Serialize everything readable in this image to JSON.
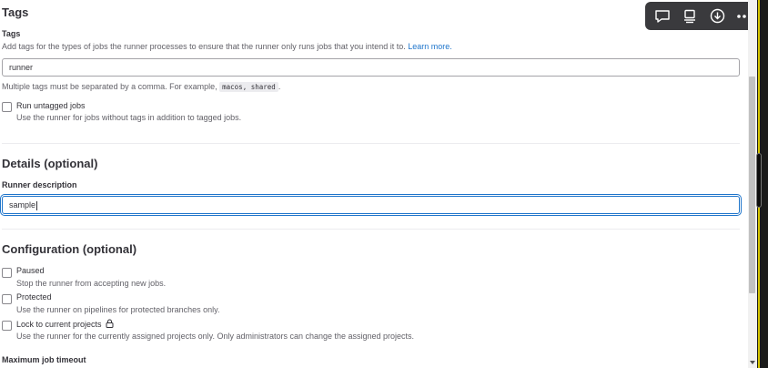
{
  "tags": {
    "section_title": "Tags",
    "label": "Tags",
    "help_text": "Add tags for the types of jobs the runner processes to ensure that the runner only runs jobs that you intend it to.",
    "learn_more": "Learn more.",
    "value": "runner",
    "separator_help_prefix": "Multiple tags must be separated by a comma. For example,",
    "separator_example": "macos, shared",
    "separator_help_suffix": ".",
    "run_untagged": {
      "label": "Run untagged jobs",
      "help": "Use the runner for jobs without tags in addition to tagged jobs.",
      "checked": false
    }
  },
  "details": {
    "section_title": "Details (optional)",
    "description_label": "Runner description",
    "description_value": "sample"
  },
  "configuration": {
    "section_title": "Configuration (optional)",
    "paused": {
      "label": "Paused",
      "help": "Stop the runner from accepting new jobs.",
      "checked": false
    },
    "protected": {
      "label": "Protected",
      "help": "Use the runner on pipelines for protected branches only.",
      "checked": false
    },
    "locked": {
      "label": "Lock to current projects",
      "help": "Use the runner for the currently assigned projects only. Only administrators can change the assigned projects.",
      "checked": false
    },
    "max_timeout_label": "Maximum job timeout"
  },
  "toolbar": {
    "icons": [
      "comment-icon",
      "screen-icon",
      "download-icon",
      "more-icon"
    ]
  },
  "colors": {
    "link": "#1f75cb",
    "focus_border": "#1f75cb",
    "toolbar_bg": "#3a3a3d",
    "edge_accent": "#d7c600"
  }
}
